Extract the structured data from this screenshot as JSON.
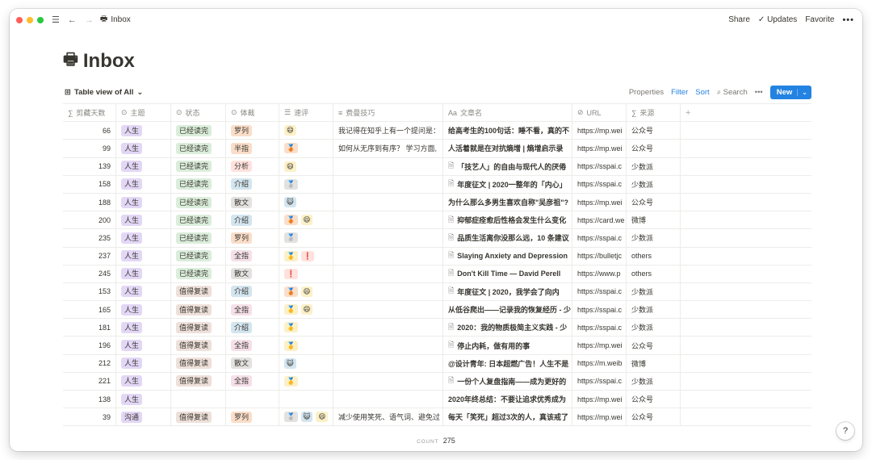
{
  "titlebar": {
    "breadcrumb": "Inbox",
    "share": "Share",
    "updates": "Updates",
    "favorite": "Favorite",
    "more": "•••",
    "traffic_colors": [
      "#ff5f57",
      "#febc2e",
      "#28c840"
    ]
  },
  "page": {
    "emoji": "🖶",
    "title": "Inbox"
  },
  "viewbar": {
    "view_label": "Table view of All",
    "properties": "Properties",
    "filter": "Filter",
    "sort": "Sort",
    "search": "Search",
    "more": "•••",
    "new": "New"
  },
  "columns": [
    "剪藏天数",
    "主题",
    "状态",
    "体裁",
    "速评",
    "费曼技巧",
    "文章名",
    "URL",
    "来源"
  ],
  "tag_colors": {
    "人生": "t-purple",
    "沟通": "t-purple",
    "已经读完": "t-green",
    "值得复读": "t-brown",
    "罗列": "t-orange",
    "半指": "t-orange",
    "分析": "t-red",
    "介绍": "t-blue",
    "散文": "t-gray",
    "全指": "t-pink"
  },
  "rows": [
    {
      "days": "66",
      "topic": "人生",
      "status": "已经读完",
      "genre": "罗列",
      "rating": [
        "😄"
      ],
      "feynman": "我记得在知乎上有一个提问是：",
      "title": "给高考生的100句话：睡不看，真的不",
      "doc": false,
      "url": "https://mp.wei",
      "source": "公众号"
    },
    {
      "days": "99",
      "topic": "人生",
      "status": "已经读完",
      "genre": "半指",
      "rating": [
        "🥉"
      ],
      "feynman": "如何从无序到有序？ 学习方面,",
      "title": "人活着就是在对抗熵增 | 熵增启示录",
      "doc": false,
      "url": "https://mp.wei",
      "source": "公众号"
    },
    {
      "days": "139",
      "topic": "人生",
      "status": "已经读完",
      "genre": "分析",
      "rating": [
        "😄"
      ],
      "feynman": "",
      "title": "「技艺人」的自由与现代人的厌倦",
      "doc": true,
      "url": "https://sspai.c",
      "source": "少数派"
    },
    {
      "days": "158",
      "topic": "人生",
      "status": "已经读完",
      "genre": "介绍",
      "rating": [
        "🥈"
      ],
      "feynman": "",
      "title": "年度征文 | 2020一整年的「内心」",
      "doc": true,
      "url": "https://sspai.c",
      "source": "少数派"
    },
    {
      "days": "188",
      "topic": "人生",
      "status": "已经读完",
      "genre": "散文",
      "rating": [
        "😺"
      ],
      "feynman": "",
      "title": "为什么那么多男生喜欢自称\"吴彦祖\"?",
      "doc": false,
      "url": "https://mp.wei",
      "source": "公众号"
    },
    {
      "days": "200",
      "topic": "人生",
      "status": "已经读完",
      "genre": "介绍",
      "rating": [
        "🥉",
        "😄"
      ],
      "feynman": "",
      "title": "抑郁症痊愈后性格会发生什么变化",
      "doc": true,
      "url": "https://card.we",
      "source": "微博"
    },
    {
      "days": "235",
      "topic": "人生",
      "status": "已经读完",
      "genre": "罗列",
      "rating": [
        "🥈"
      ],
      "feynman": "",
      "title": "品质生活离你没那么远，10 条建议",
      "doc": true,
      "url": "https://sspai.c",
      "source": "少数派"
    },
    {
      "days": "237",
      "topic": "人生",
      "status": "已经读完",
      "genre": "全指",
      "rating": [
        "🥇",
        "❗"
      ],
      "feynman": "",
      "title": "Slaying Anxiety and Depression",
      "doc": true,
      "url": "https://bulletjc",
      "source": "others"
    },
    {
      "days": "245",
      "topic": "人生",
      "status": "已经读完",
      "genre": "散文",
      "rating": [
        "❗"
      ],
      "feynman": "",
      "title": "Don't Kill Time — David Perell",
      "doc": true,
      "url": "https://www.p",
      "source": "others"
    },
    {
      "days": "153",
      "topic": "人生",
      "status": "值得复读",
      "genre": "介绍",
      "rating": [
        "🥉",
        "😄"
      ],
      "feynman": "",
      "title": "年度征文 | 2020，我学会了向内",
      "doc": true,
      "url": "https://sspai.c",
      "source": "少数派"
    },
    {
      "days": "165",
      "topic": "人生",
      "status": "值得复读",
      "genre": "全指",
      "rating": [
        "🥇",
        "😄"
      ],
      "feynman": "",
      "title": "从低谷爬出——记录我的恢复经历 - 少",
      "doc": false,
      "url": "https://sspai.c",
      "source": "少数派"
    },
    {
      "days": "181",
      "topic": "人生",
      "status": "值得复读",
      "genre": "介绍",
      "rating": [
        "🥇"
      ],
      "feynman": "",
      "title": "2020：我的物质极简主义实践 - 少",
      "doc": true,
      "url": "https://sspai.c",
      "source": "少数派"
    },
    {
      "days": "196",
      "topic": "人生",
      "status": "值得复读",
      "genre": "全指",
      "rating": [
        "🥇"
      ],
      "feynman": "",
      "title": "停止内耗，做有用的事",
      "doc": true,
      "url": "https://mp.wei",
      "source": "公众号"
    },
    {
      "days": "212",
      "topic": "人生",
      "status": "值得复读",
      "genre": "散文",
      "rating": [
        "😺"
      ],
      "feynman": "",
      "title": "@设计青年: 日本超燃广告！人生不是",
      "doc": false,
      "url": "https://m.weib",
      "source": "微博"
    },
    {
      "days": "221",
      "topic": "人生",
      "status": "值得复读",
      "genre": "全指",
      "rating": [
        "🥇"
      ],
      "feynman": "",
      "title": "一份个人复盘指南——成为更好的",
      "doc": true,
      "url": "https://sspai.c",
      "source": "少数派"
    },
    {
      "days": "138",
      "topic": "人生",
      "status": "",
      "genre": "",
      "rating": [],
      "feynman": "",
      "title": "2020年终总结：不要让追求优秀成为",
      "doc": false,
      "url": "https://mp.wei",
      "source": "公众号"
    },
    {
      "days": "39",
      "topic": "沟通",
      "status": "值得复读",
      "genre": "罗列",
      "rating": [
        "🥈",
        "😺",
        "😄"
      ],
      "feynman": "减少使用笑死、语气词、避免过",
      "title": "每天「笑死」超过3次的人，真该戒了",
      "doc": false,
      "url": "https://mp.wei",
      "source": "公众号"
    }
  ],
  "footer": {
    "count_label": "COUNT",
    "count_value": "275"
  },
  "help": "?"
}
